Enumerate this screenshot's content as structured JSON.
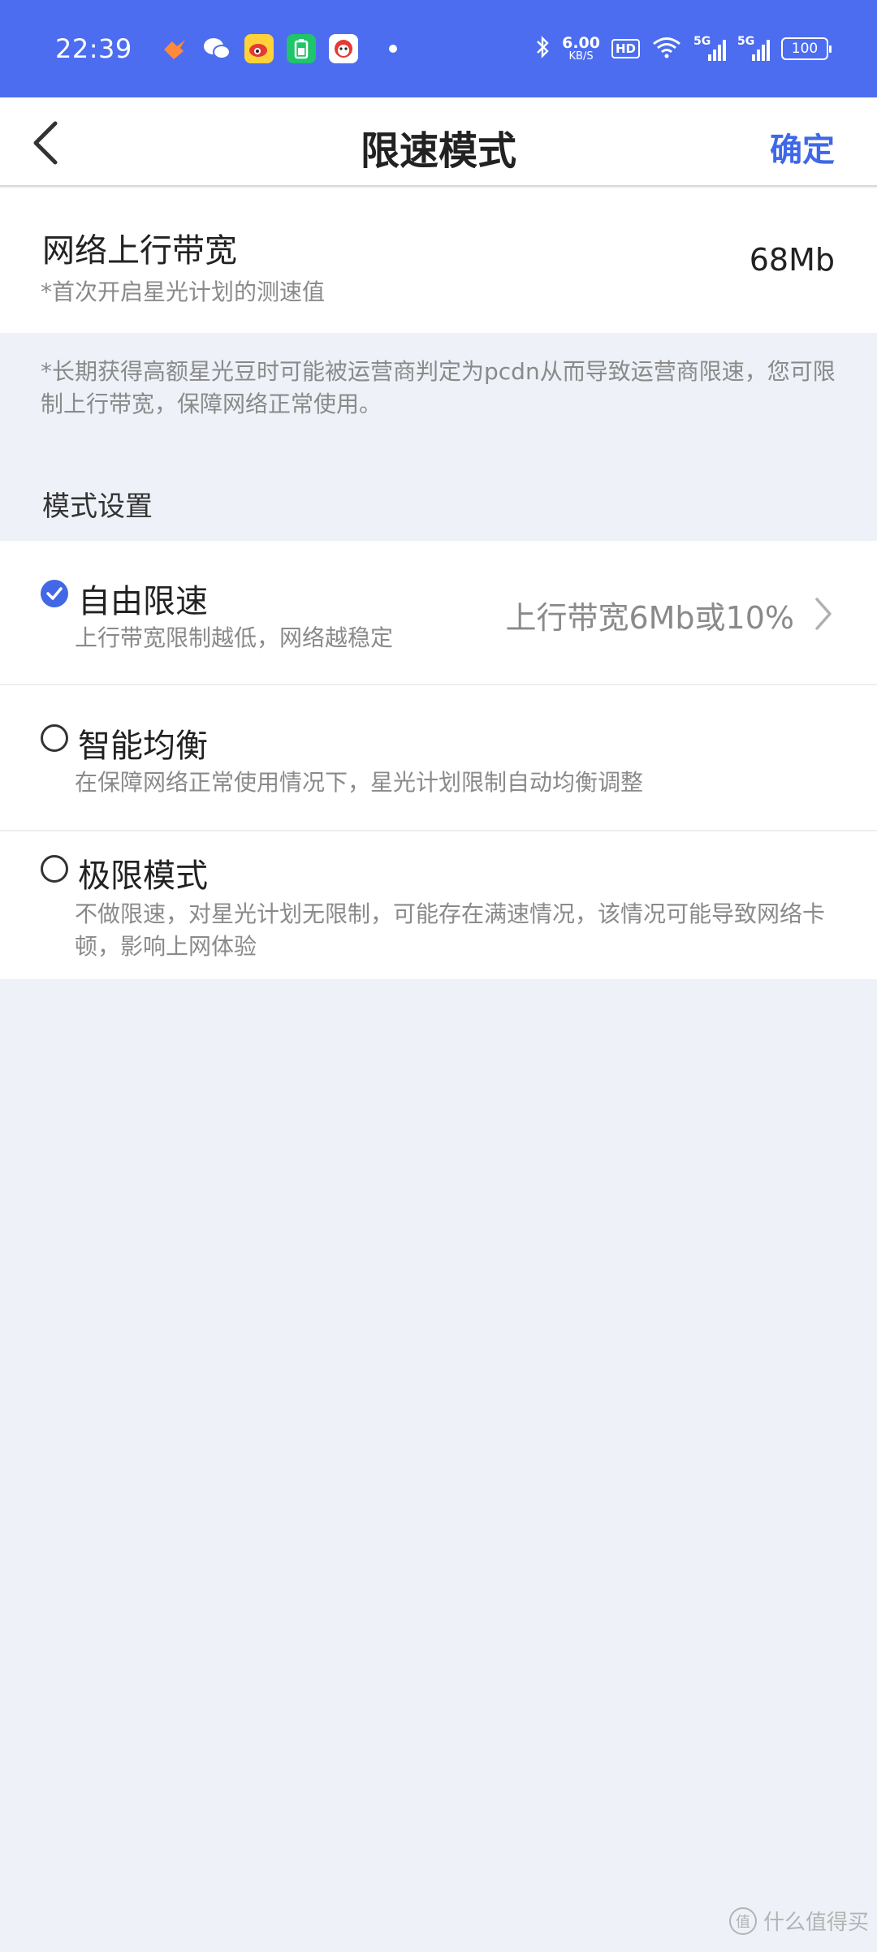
{
  "status_bar": {
    "time": "22:39",
    "apps": [
      {
        "icon": "tao-icon",
        "glyph": "❤",
        "bg": "transparent",
        "color": "#ff8a3c"
      },
      {
        "icon": "wechat-icon",
        "glyph": "✉",
        "bg": "transparent",
        "color": "#ffffff"
      },
      {
        "icon": "weibo-icon",
        "glyph": "◉",
        "bg": "#ffd23a",
        "color": "#e53935"
      },
      {
        "icon": "battery-app-icon",
        "glyph": "▮",
        "bg": "#20c46a",
        "color": "#ffffff"
      },
      {
        "icon": "mascot-app-icon",
        "glyph": "☻",
        "bg": "#e53935",
        "color": "#ffffff"
      }
    ],
    "speed_value": "6.00",
    "speed_unit": "KB/S",
    "hd": "HD",
    "sim1": "5G",
    "sim2": "5G",
    "battery": "100"
  },
  "nav": {
    "title": "限速模式",
    "confirm": "确定"
  },
  "bandwidth": {
    "title": "网络上行带宽",
    "subtitle": "*首次开启星光计划的测速值",
    "value": "68Mb"
  },
  "note": "*长期获得高额星光豆时可能被运营商判定为pcdn从而导致运营商限速，您可限制上行带宽，保障网络正常使用。",
  "section_title": "模式设置",
  "modes": [
    {
      "name": "自由限速",
      "desc": "上行带宽限制越低，网络越稳定",
      "value": "上行带宽6Mb或10%",
      "checked": true
    },
    {
      "name": "智能均衡",
      "desc": "在保障网络正常使用情况下，星光计划限制自动均衡调整",
      "checked": false
    },
    {
      "name": "极限模式",
      "desc": "不做限速，对星光计划无限制，可能存在满速情况，该情况可能导致网络卡顿，影响上网体验",
      "checked": false
    }
  ],
  "watermark": "什么值得买",
  "colors": {
    "status_bar_bg": "#4c6df0",
    "accent": "#3e68e8",
    "page_bg": "#eef2f8"
  }
}
